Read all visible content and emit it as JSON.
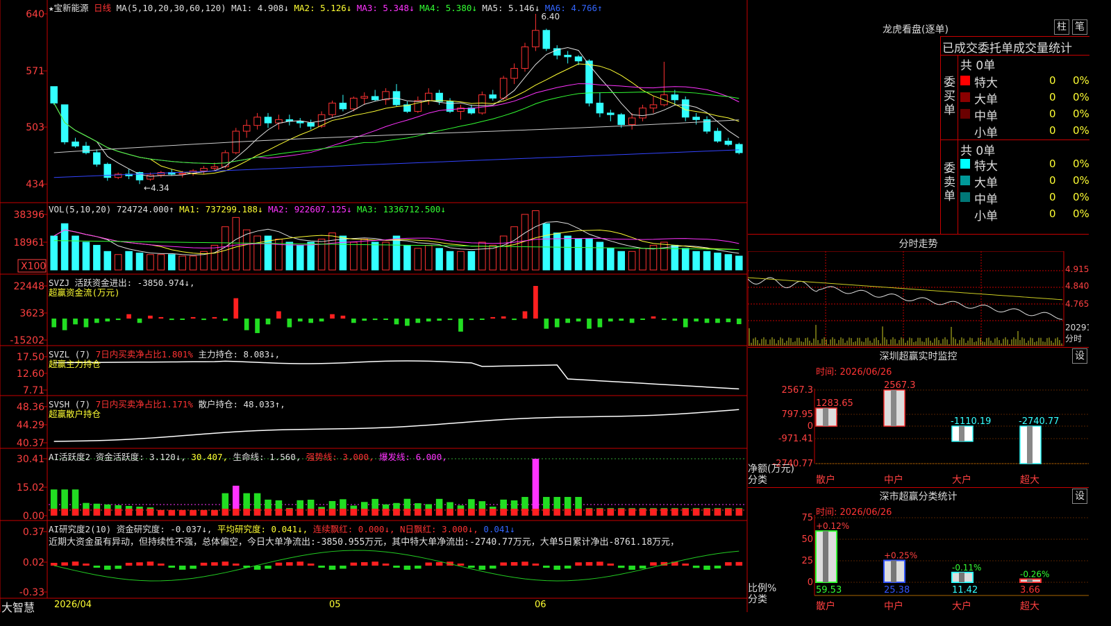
{
  "stock": {
    "name": "★宝新能源",
    "period": "日线"
  },
  "kline": {
    "ma_header": [
      {
        "t": "MA(5,10,20,30,60,120)",
        "c": "#e0e0e0"
      },
      {
        "t": "MA1: 4.908↓",
        "c": "#e0e0e0"
      },
      {
        "t": "MA2: 5.126↓",
        "c": "#ffff33"
      },
      {
        "t": "MA3: 5.348↓",
        "c": "#ff33ff"
      },
      {
        "t": "MA4: 5.380↓",
        "c": "#33ff33"
      },
      {
        "t": "MA5: 5.146↓",
        "c": "#e0e0e0"
      },
      {
        "t": "MA6: 4.766↑",
        "c": "#3366ff"
      }
    ],
    "ytick_values": [
      "640",
      "571",
      "503",
      "434"
    ],
    "high_label": "6.40",
    "low_label": "←4.34"
  },
  "vol": {
    "header": [
      {
        "t": "VOL(5,10,20)",
        "c": "#e0e0e0"
      },
      {
        "t": "724724.000↑",
        "c": "#e0e0e0"
      },
      {
        "t": "MA1: 737299.188↓",
        "c": "#ffff33"
      },
      {
        "t": "MA2: 922607.125↓",
        "c": "#ff33ff"
      },
      {
        "t": "MA3: 1336712.500↓",
        "c": "#33ff33"
      }
    ],
    "yticks": [
      "38396",
      "18961"
    ],
    "unit": "X100"
  },
  "svzj": {
    "header": [
      {
        "t": "SVZJ",
        "c": "#e0e0e0"
      },
      {
        "t": "活跃资金进出: -3850.974↓,",
        "c": "#e0e0e0"
      }
    ],
    "header2": "超赢资金流(万元)",
    "yticks": [
      "22448",
      "3623",
      "-15202"
    ]
  },
  "svzl": {
    "header": [
      {
        "t": "SVZL (7)",
        "c": "#e0e0e0"
      },
      {
        "t": "7日内买卖净占比1.801%",
        "c": "#ff3333"
      },
      {
        "t": "主力持仓: 8.083↓,",
        "c": "#e0e0e0"
      }
    ],
    "header2": "超赢主力持仓",
    "yticks": [
      "17.50",
      "12.60",
      "7.71"
    ]
  },
  "svsh": {
    "header": [
      {
        "t": "SVSH (7)",
        "c": "#e0e0e0"
      },
      {
        "t": "7日内买卖净占比1.171%",
        "c": "#ff3333"
      },
      {
        "t": "散户持仓: 48.033↑,",
        "c": "#e0e0e0"
      }
    ],
    "header2": "超赢散户持仓",
    "yticks": [
      "48.36",
      "44.29",
      "40.37"
    ]
  },
  "ai_active": {
    "header": [
      {
        "t": "AI活跃度2 资金活跃度: 3.120↓,",
        "c": "#e0e0e0"
      },
      {
        "t": "30.407,",
        "c": "#ffff33"
      },
      {
        "t": "生命线: 1.560,",
        "c": "#e0e0e0"
      },
      {
        "t": "强势线: 3.000,",
        "c": "#ff3333"
      },
      {
        "t": "爆发线: 6.000,",
        "c": "#ff33ff"
      }
    ],
    "yticks": [
      "30.41",
      "15.02",
      "0.00"
    ]
  },
  "ai_research": {
    "header": [
      {
        "t": "AI研究度2(10) 资金研究度: -0.037↓,",
        "c": "#e0e0e0"
      },
      {
        "t": "平均研究度: 0.041↓,",
        "c": "#ffff33"
      },
      {
        "t": "连续飘红: 0.000↓,",
        "c": "#ff3333"
      },
      {
        "t": "N日飘红: 3.000↓,",
        "c": "#ff3333"
      },
      {
        "t": "0.041↓",
        "c": "#3366ff"
      }
    ],
    "comment": "近期大资金虽有异动，但持续性不强，总体偏空，今日大单净流出:-3850.955万元，其中特大单净流出:-2740.77万元，大单5日累计净出-8761.18万元，",
    "yticks": [
      "0.37",
      "0.02",
      "-0.33"
    ]
  },
  "xaxis": {
    "labels": [
      "2026/04",
      "05",
      "06"
    ]
  },
  "brand": "大智慧",
  "right": {
    "title": "龙虎看盘(逐单)",
    "btn_zhu": "柱",
    "btn_bi": "笔",
    "table_title": "已成交委托单成交量统计",
    "buy_side": "委买单",
    "sell_side": "委卖单",
    "buy_total": "共 0单",
    "sell_total": "共 0单",
    "buy_rows": [
      {
        "label": "特大",
        "color": "#ff0000",
        "count": "0",
        "pct": "0%"
      },
      {
        "label": "大单",
        "color": "#8b0000",
        "count": "0",
        "pct": "0%"
      },
      {
        "label": "中单",
        "color": "#6a0000",
        "count": "0",
        "pct": "0%"
      },
      {
        "label": "小单",
        "color": "",
        "count": "0",
        "pct": "0%"
      }
    ],
    "sell_rows": [
      {
        "label": "特大",
        "color": "#00ffff",
        "count": "0",
        "pct": "0%"
      },
      {
        "label": "大单",
        "color": "#009999",
        "count": "0",
        "pct": "0%"
      },
      {
        "label": "中单",
        "color": "#007777",
        "count": "0",
        "pct": "0%"
      },
      {
        "label": "小单",
        "color": "",
        "count": "0",
        "pct": "0%"
      }
    ],
    "intraday_title": "分时走势",
    "intraday_ticks": [
      "4.915",
      "4.840",
      "4.765",
      "20291",
      "分时"
    ],
    "sz_monitor_title": "深圳超赢实时监控",
    "sz_btn": "设",
    "sz_time": "时间: 2026/06/26",
    "sz_yticks": [
      "2567.3",
      "797.95",
      "0",
      "-971.41",
      "-2740.77"
    ],
    "sz_yaxis_name": "净额(万元)",
    "sz_cat_name": "分类",
    "sz_bars": [
      {
        "cat": "散户",
        "value": 1283.65,
        "label": "1283.65"
      },
      {
        "cat": "中户",
        "value": 2567.3,
        "label": "2567.3"
      },
      {
        "cat": "大户",
        "value": -1110.19,
        "label": "-1110.19"
      },
      {
        "cat": "超大",
        "value": -2740.77,
        "label": "-2740.77"
      }
    ],
    "cls_title": "深市超赢分类统计",
    "cls_btn": "设",
    "cls_time": "时间: 2026/06/26",
    "cls_yticks": [
      "75",
      "50",
      "25",
      "0"
    ],
    "cls_yaxis_name": "比例%",
    "cls_cat_name": "分类",
    "cls_bars": [
      {
        "cat": "散户",
        "value": 59.53,
        "label": "59.53",
        "chg": "+0.12%",
        "color": "#33ff33"
      },
      {
        "cat": "中户",
        "value": 25.38,
        "label": "25.38",
        "chg": "+0.25%",
        "color": "#3355ff"
      },
      {
        "cat": "大户",
        "value": 11.42,
        "label": "11.42",
        "chg": "-0.11%",
        "color": "#33ffff"
      },
      {
        "cat": "超大",
        "value": 3.66,
        "label": "3.66",
        "chg": "-0.26%",
        "color": "#ff3333"
      }
    ]
  },
  "chart_data": {
    "type": "candlestick",
    "title": "宝新能源 日线",
    "ylim": [
      4.3,
      6.45
    ],
    "x_labels": [
      "2026/04",
      "05",
      "06"
    ],
    "ohlc": [
      [
        5.52,
        5.52,
        5.3,
        5.32
      ],
      [
        5.3,
        5.3,
        4.82,
        4.85
      ],
      [
        4.85,
        4.9,
        4.78,
        4.8
      ],
      [
        4.8,
        4.85,
        4.7,
        4.72
      ],
      [
        4.72,
        4.76,
        4.55,
        4.58
      ],
      [
        4.58,
        4.6,
        4.38,
        4.42
      ],
      [
        4.42,
        4.48,
        4.4,
        4.46
      ],
      [
        4.46,
        4.52,
        4.4,
        4.44
      ],
      [
        4.48,
        4.49,
        4.34,
        4.39
      ],
      [
        4.4,
        4.48,
        4.38,
        4.45
      ],
      [
        4.45,
        4.5,
        4.42,
        4.48
      ],
      [
        4.48,
        4.52,
        4.44,
        4.46
      ],
      [
        4.46,
        4.5,
        4.42,
        4.47
      ],
      [
        4.47,
        4.52,
        4.44,
        4.5
      ],
      [
        4.5,
        4.56,
        4.46,
        4.53
      ],
      [
        4.53,
        4.6,
        4.5,
        4.55
      ],
      [
        4.55,
        4.75,
        4.53,
        4.72
      ],
      [
        4.72,
        5.02,
        4.7,
        4.98
      ],
      [
        4.98,
        5.12,
        4.9,
        5.05
      ],
      [
        5.05,
        5.2,
        5.0,
        5.15
      ],
      [
        5.15,
        5.2,
        5.02,
        5.08
      ],
      [
        5.08,
        5.18,
        5.0,
        5.12
      ],
      [
        5.12,
        5.18,
        5.05,
        5.1
      ],
      [
        5.1,
        5.14,
        5.02,
        5.08
      ],
      [
        5.08,
        5.12,
        5.0,
        5.04
      ],
      [
        5.04,
        5.22,
        5.02,
        5.18
      ],
      [
        5.18,
        5.35,
        5.15,
        5.32
      ],
      [
        5.32,
        5.42,
        5.22,
        5.25
      ],
      [
        5.25,
        5.4,
        5.22,
        5.38
      ],
      [
        5.38,
        5.45,
        5.3,
        5.4
      ],
      [
        5.4,
        5.48,
        5.34,
        5.36
      ],
      [
        5.36,
        5.5,
        5.3,
        5.46
      ],
      [
        5.46,
        5.55,
        5.28,
        5.3
      ],
      [
        5.3,
        5.34,
        5.2,
        5.22
      ],
      [
        5.22,
        5.4,
        5.2,
        5.35
      ],
      [
        5.35,
        5.5,
        5.3,
        5.44
      ],
      [
        5.44,
        5.48,
        5.3,
        5.34
      ],
      [
        5.34,
        5.38,
        5.2,
        5.22
      ],
      [
        5.22,
        5.3,
        5.12,
        5.26
      ],
      [
        5.26,
        5.3,
        5.18,
        5.2
      ],
      [
        5.2,
        5.46,
        5.18,
        5.42
      ],
      [
        5.42,
        5.48,
        5.35,
        5.38
      ],
      [
        5.38,
        5.65,
        5.36,
        5.62
      ],
      [
        5.62,
        5.8,
        5.55,
        5.74
      ],
      [
        5.74,
        6.05,
        5.7,
        6.0
      ],
      [
        6.0,
        6.4,
        5.95,
        6.2
      ],
      [
        6.2,
        6.22,
        5.95,
        5.98
      ],
      [
        5.98,
        6.02,
        5.85,
        5.9
      ],
      [
        5.9,
        5.95,
        5.8,
        5.88
      ],
      [
        5.88,
        5.9,
        5.78,
        5.83
      ],
      [
        5.83,
        5.85,
        5.28,
        5.32
      ],
      [
        5.32,
        5.45,
        5.15,
        5.2
      ],
      [
        5.2,
        5.24,
        5.1,
        5.18
      ],
      [
        5.18,
        5.2,
        5.02,
        5.06
      ],
      [
        5.06,
        5.2,
        5.0,
        5.14
      ],
      [
        5.14,
        5.3,
        5.1,
        5.26
      ],
      [
        5.26,
        5.4,
        5.2,
        5.3
      ],
      [
        5.3,
        5.82,
        5.28,
        5.42
      ],
      [
        5.42,
        5.48,
        5.3,
        5.36
      ],
      [
        5.36,
        5.4,
        5.1,
        5.15
      ],
      [
        5.15,
        5.2,
        5.06,
        5.12
      ],
      [
        5.12,
        5.16,
        4.95,
        4.98
      ],
      [
        4.98,
        5.02,
        4.84,
        4.86
      ],
      [
        4.86,
        4.9,
        4.8,
        4.82
      ],
      [
        4.82,
        4.84,
        4.7,
        4.72
      ]
    ],
    "volume": [
      [
        22000,
        -1
      ],
      [
        30000,
        -1
      ],
      [
        22000,
        -1
      ],
      [
        18000,
        -1
      ],
      [
        16000,
        -1
      ],
      [
        12000,
        -1
      ],
      [
        10000,
        1
      ],
      [
        12000,
        -1
      ],
      [
        11000,
        -1
      ],
      [
        10000,
        1
      ],
      [
        10000,
        1
      ],
      [
        10000,
        -1
      ],
      [
        9000,
        1
      ],
      [
        9000,
        1
      ],
      [
        12000,
        1
      ],
      [
        16000,
        1
      ],
      [
        28000,
        1
      ],
      [
        34000,
        1
      ],
      [
        26000,
        1
      ],
      [
        22000,
        1
      ],
      [
        22000,
        -1
      ],
      [
        20000,
        1
      ],
      [
        18000,
        -1
      ],
      [
        16000,
        -1
      ],
      [
        18000,
        -1
      ],
      [
        20000,
        1
      ],
      [
        24000,
        1
      ],
      [
        22000,
        -1
      ],
      [
        18000,
        1
      ],
      [
        20000,
        1
      ],
      [
        18000,
        -1
      ],
      [
        18000,
        1
      ],
      [
        22000,
        -1
      ],
      [
        16000,
        -1
      ],
      [
        14000,
        1
      ],
      [
        16000,
        1
      ],
      [
        14000,
        -1
      ],
      [
        12000,
        -1
      ],
      [
        12000,
        1
      ],
      [
        12000,
        -1
      ],
      [
        18000,
        1
      ],
      [
        16000,
        1
      ],
      [
        22000,
        1
      ],
      [
        28000,
        1
      ],
      [
        36000,
        1
      ],
      [
        38396,
        1
      ],
      [
        30000,
        -1
      ],
      [
        24000,
        -1
      ],
      [
        22000,
        -1
      ],
      [
        20000,
        -1
      ],
      [
        20000,
        -1
      ],
      [
        18000,
        -1
      ],
      [
        14000,
        -1
      ],
      [
        12000,
        -1
      ],
      [
        12000,
        1
      ],
      [
        14000,
        1
      ],
      [
        16000,
        1
      ],
      [
        18000,
        1
      ],
      [
        16000,
        -1
      ],
      [
        14000,
        -1
      ],
      [
        12000,
        -1
      ],
      [
        12000,
        -1
      ],
      [
        11000,
        -1
      ],
      [
        10000,
        -1
      ],
      [
        9000,
        -1
      ]
    ],
    "svzj": [
      -6000,
      -8000,
      -4000,
      -6000,
      -3000,
      -2000,
      -1000,
      3000,
      -3000,
      2000,
      1000,
      -1000,
      -500,
      1000,
      -1000,
      1000,
      -1500,
      14000,
      -8000,
      -10000,
      -4000,
      5000,
      -6000,
      -2000,
      -3000,
      -2000,
      3000,
      2000,
      -3000,
      -1500,
      -1000,
      -500,
      -4000,
      -5000,
      -3000,
      -2000,
      -1500,
      -1000,
      -9000,
      -1000,
      -500,
      1000,
      1500,
      -1000,
      5000,
      22448,
      -7000,
      -6000,
      -3000,
      -2000,
      -7000,
      -6000,
      -2000,
      -1500,
      -3000,
      -500,
      1500,
      -1000,
      -1500,
      -6000,
      -2000,
      -3000,
      -3000,
      -2500,
      -3850
    ]
  }
}
